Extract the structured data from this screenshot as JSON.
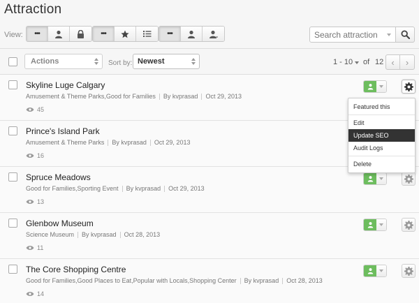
{
  "page": {
    "title": "Attraction"
  },
  "toolbar": {
    "view_label": "View:",
    "group1": [
      {
        "icon": "more-dots-icon",
        "active": true,
        "glyph": "•••"
      },
      {
        "icon": "user-icon",
        "active": false
      },
      {
        "icon": "lock-icon",
        "active": false
      }
    ],
    "group2": [
      {
        "icon": "more-dots-icon",
        "active": true,
        "glyph": "•••"
      },
      {
        "icon": "star-icon",
        "active": false
      },
      {
        "icon": "list-icon",
        "active": false
      }
    ],
    "group3": [
      {
        "icon": "more-dots-icon",
        "active": true,
        "glyph": "•••"
      },
      {
        "icon": "user-icon",
        "active": false
      },
      {
        "icon": "user-icon",
        "active": false
      }
    ],
    "search_placeholder": "Search attraction"
  },
  "controls": {
    "actions_label": "Actions",
    "sort_label": "Sort by:",
    "sort_value": "Newest",
    "pager_range": "1 - 10",
    "pager_of": "of",
    "pager_total": "12",
    "prev_glyph": "‹",
    "next_glyph": "›"
  },
  "items": [
    {
      "title": "Skyline Luge Calgary",
      "categories": "Amusement & Theme Parks,Good for Families",
      "author": "By kvprasad",
      "date": "Oct 29, 2013",
      "views": "45"
    },
    {
      "title": "Prince's Island Park",
      "categories": "Amusement & Theme Parks",
      "author": "By kvprasad",
      "date": "Oct 29, 2013",
      "views": "16"
    },
    {
      "title": "Spruce Meadows",
      "categories": "Good for Families,Sporting Event",
      "author": "By kvprasad",
      "date": "Oct 29, 2013",
      "views": "13"
    },
    {
      "title": "Glenbow Museum",
      "categories": "Science Museum",
      "author": "By kvprasad",
      "date": "Oct 28, 2013",
      "views": "11"
    },
    {
      "title": "The Core Shopping Centre",
      "categories": "Good for Families,Good Places to Eat,Popular with Locals,Shopping Center",
      "author": "By kvprasad",
      "date": "Oct 28, 2013",
      "views": "14"
    }
  ],
  "menu": {
    "featured": "Featured this",
    "edit": "Edit",
    "update_seo": "Update SEO",
    "audit_logs": "Audit Logs",
    "delete": "Delete"
  },
  "colors": {
    "status_green": "#6dbd5e",
    "menu_selected": "#333333"
  }
}
